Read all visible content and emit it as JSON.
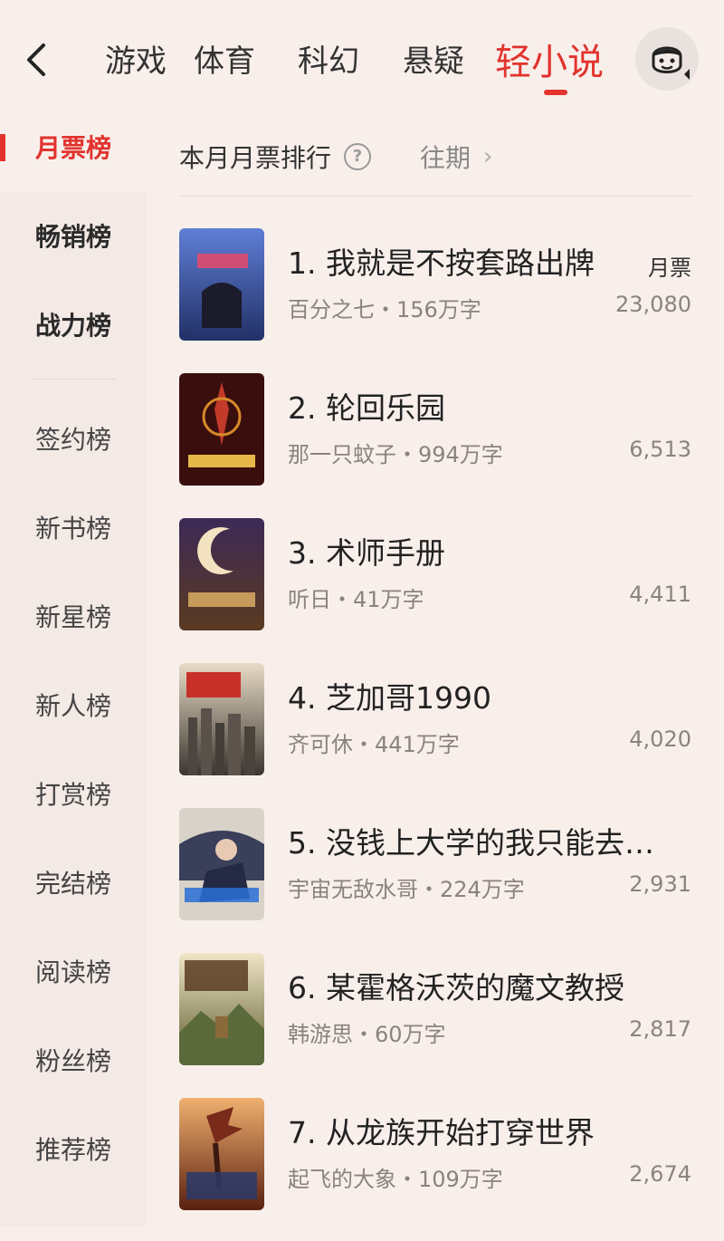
{
  "header": {
    "tabs": [
      {
        "label": "游戏",
        "active": false
      },
      {
        "label": "体育",
        "active": false
      },
      {
        "label": "科幻",
        "active": false
      },
      {
        "label": "悬疑",
        "active": false
      },
      {
        "label": "轻小说",
        "active": true
      }
    ]
  },
  "sidebar": {
    "items": [
      {
        "label": "月票榜",
        "active": true
      },
      {
        "label": "畅销榜"
      },
      {
        "label": "战力榜"
      },
      {
        "label": "签约榜"
      },
      {
        "label": "新书榜"
      },
      {
        "label": "新星榜"
      },
      {
        "label": "新人榜"
      },
      {
        "label": "打赏榜"
      },
      {
        "label": "完结榜"
      },
      {
        "label": "阅读榜"
      },
      {
        "label": "粉丝榜"
      },
      {
        "label": "推荐榜"
      }
    ]
  },
  "main": {
    "subtitle": "本月月票排行",
    "history_label": "往期",
    "vote_label": "月票",
    "books": [
      {
        "title": "1. 我就是不按套路出牌",
        "meta": "百分之七・156万字",
        "votes": "23,080",
        "cover": "#3b4a8a"
      },
      {
        "title": "2. 轮回乐园",
        "meta": "那一只蚊子・994万字",
        "votes": "6,513",
        "cover": "#7a1a16"
      },
      {
        "title": "3. 术师手册",
        "meta": "听日・41万字",
        "votes": "4,411",
        "cover": "#2a2438"
      },
      {
        "title": "4. 芝加哥1990",
        "meta": "齐可休・441万字",
        "votes": "4,020",
        "cover": "#6b5a48"
      },
      {
        "title": "5. 没钱上大学的我只能去…",
        "meta": "宇宙无敌水哥・224万字",
        "votes": "2,931",
        "cover": "#4a4f66"
      },
      {
        "title": "6. 某霍格沃茨的魔文教授",
        "meta": "韩游思・60万字",
        "votes": "2,817",
        "cover": "#8a7a3a"
      },
      {
        "title": "7. 从龙族开始打穿世界",
        "meta": "起飞的大象・109万字",
        "votes": "2,674",
        "cover": "#9a4a20"
      }
    ]
  },
  "colors": {
    "accent": "#e2332e",
    "background": "#f8efeb"
  }
}
